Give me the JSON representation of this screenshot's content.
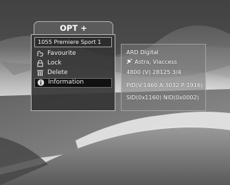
{
  "menu": {
    "title": "OPT +",
    "channel": "1055  Premiere Sport 1",
    "items": [
      {
        "label": "Favourite",
        "icon": "favourite-icon",
        "selected": false
      },
      {
        "label": "Lock",
        "icon": "lock-icon",
        "selected": false
      },
      {
        "label": "Delete",
        "icon": "trash-icon",
        "selected": false
      },
      {
        "label": "Information",
        "icon": "info-icon",
        "selected": true
      }
    ]
  },
  "info": {
    "provider": "ARD Digital",
    "satellite": "Astra, Viaccess",
    "transponder": "4800 (V) 28125 3/4",
    "pids": "PID(V:1460 A:3032 P:1916)",
    "sid_nid": "SID(0x1160) NID(0x0002)"
  }
}
